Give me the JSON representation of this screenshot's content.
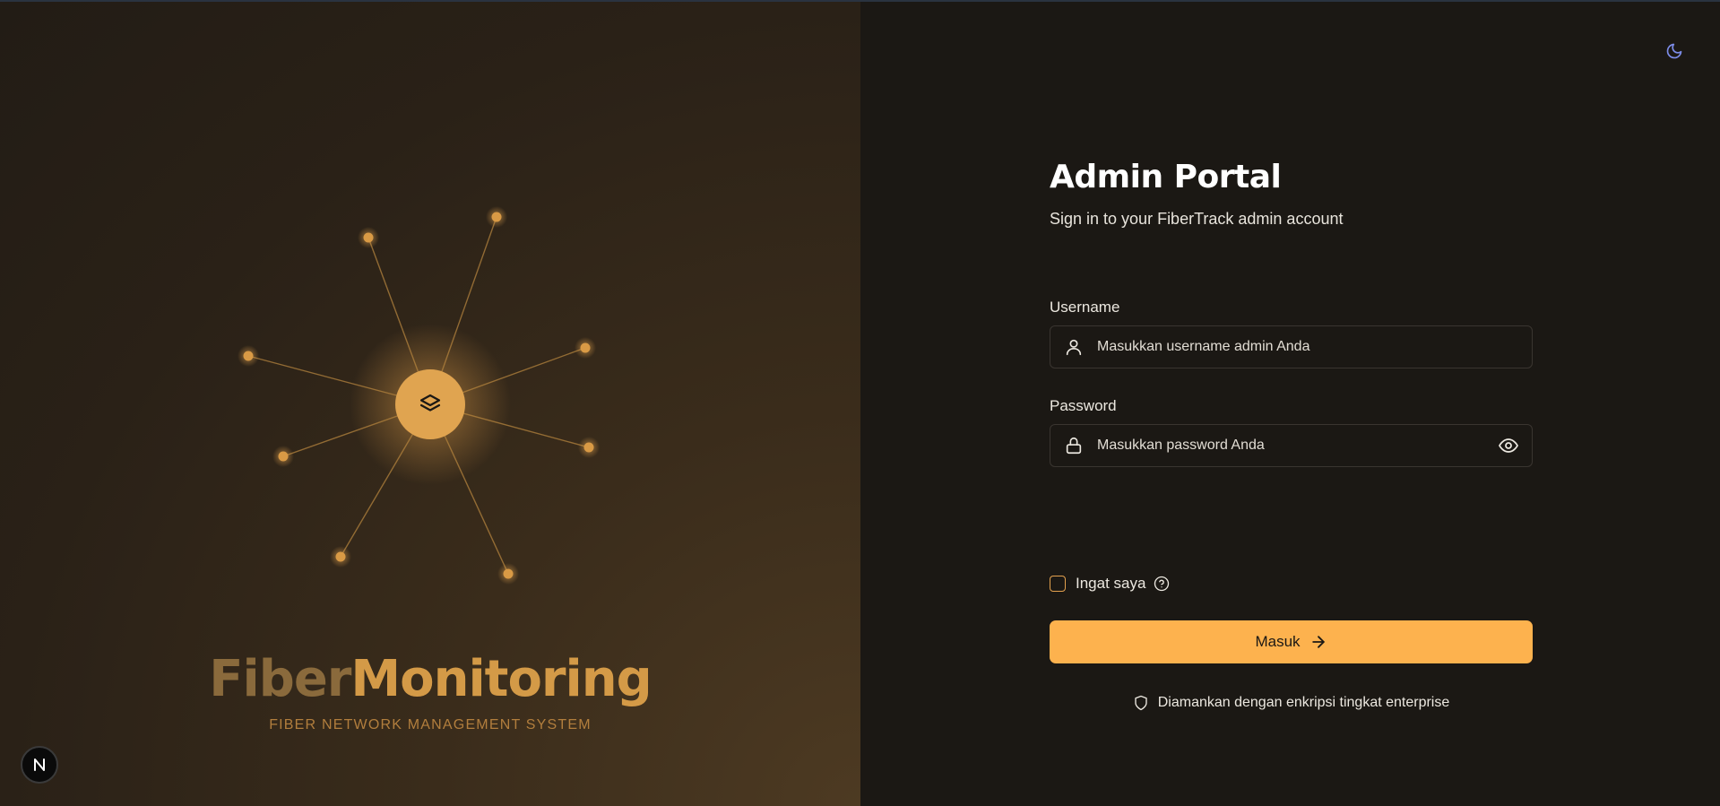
{
  "brand": {
    "part1": "Fiber",
    "part2": "Monitoring",
    "tagline": "FIBER NETWORK MANAGEMENT SYSTEM"
  },
  "next_badge": "N",
  "login": {
    "title": "Admin Portal",
    "subtitle": "Sign in to your FiberTrack admin account",
    "username_label": "Username",
    "username_placeholder": "Masukkan username admin Anda",
    "password_label": "Password",
    "password_placeholder": "Masukkan password Anda",
    "remember_label": "Ingat saya",
    "submit_label": "Masuk",
    "security_note": "Diamankan dengan enkripsi tingkat enterprise"
  },
  "colors": {
    "accent": "#fdb24e",
    "node": "#d99a45",
    "background": "#1b1814",
    "theme_icon": "#7c8ce8"
  },
  "icons": {
    "theme": "moon-icon",
    "hub": "layers-icon",
    "username": "user-icon",
    "password": "lock-icon",
    "reveal": "eye-icon",
    "help": "help-circle-icon",
    "submit": "arrow-right-icon",
    "security": "shield-icon"
  }
}
